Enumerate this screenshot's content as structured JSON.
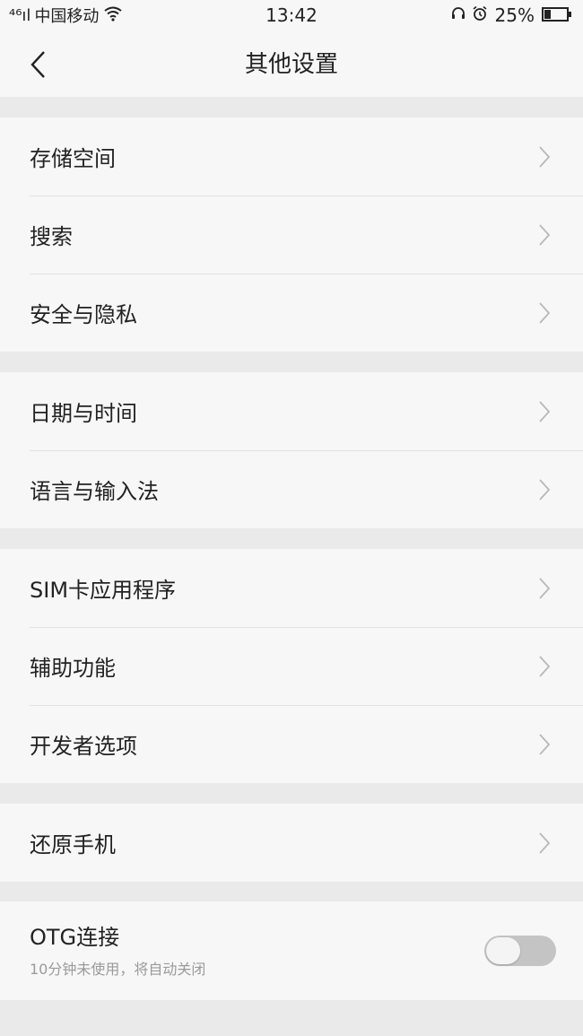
{
  "status_bar": {
    "signal_prefix": "⁴⁶ıl",
    "carrier": "中国移动",
    "time": "13:42",
    "battery": "25%"
  },
  "header": {
    "title": "其他设置"
  },
  "sections": [
    {
      "items": [
        {
          "label": "存储空间"
        },
        {
          "label": "搜索"
        },
        {
          "label": "安全与隐私"
        }
      ]
    },
    {
      "items": [
        {
          "label": "日期与时间"
        },
        {
          "label": "语言与输入法"
        }
      ]
    },
    {
      "items": [
        {
          "label": "SIM卡应用程序"
        },
        {
          "label": "辅助功能"
        },
        {
          "label": "开发者选项"
        }
      ]
    },
    {
      "items": [
        {
          "label": "还原手机"
        }
      ]
    }
  ],
  "otg": {
    "title": "OTG连接",
    "subtitle": "10分钟未使用，将自动关闭",
    "enabled": false
  },
  "icons": {
    "back": "chevron-left-icon",
    "row_arrow": "chevron-right-icon",
    "wifi": "wifi-icon",
    "headset": "headset-icon",
    "alarm": "alarm-icon",
    "battery": "battery-icon"
  },
  "colors": {
    "background": "#eaeaea",
    "surface": "#f7f7f7",
    "text": "#222222",
    "secondary_text": "#9a9a9a",
    "divider": "#e2e2e2",
    "toggle_off": "#c4c4c4"
  }
}
